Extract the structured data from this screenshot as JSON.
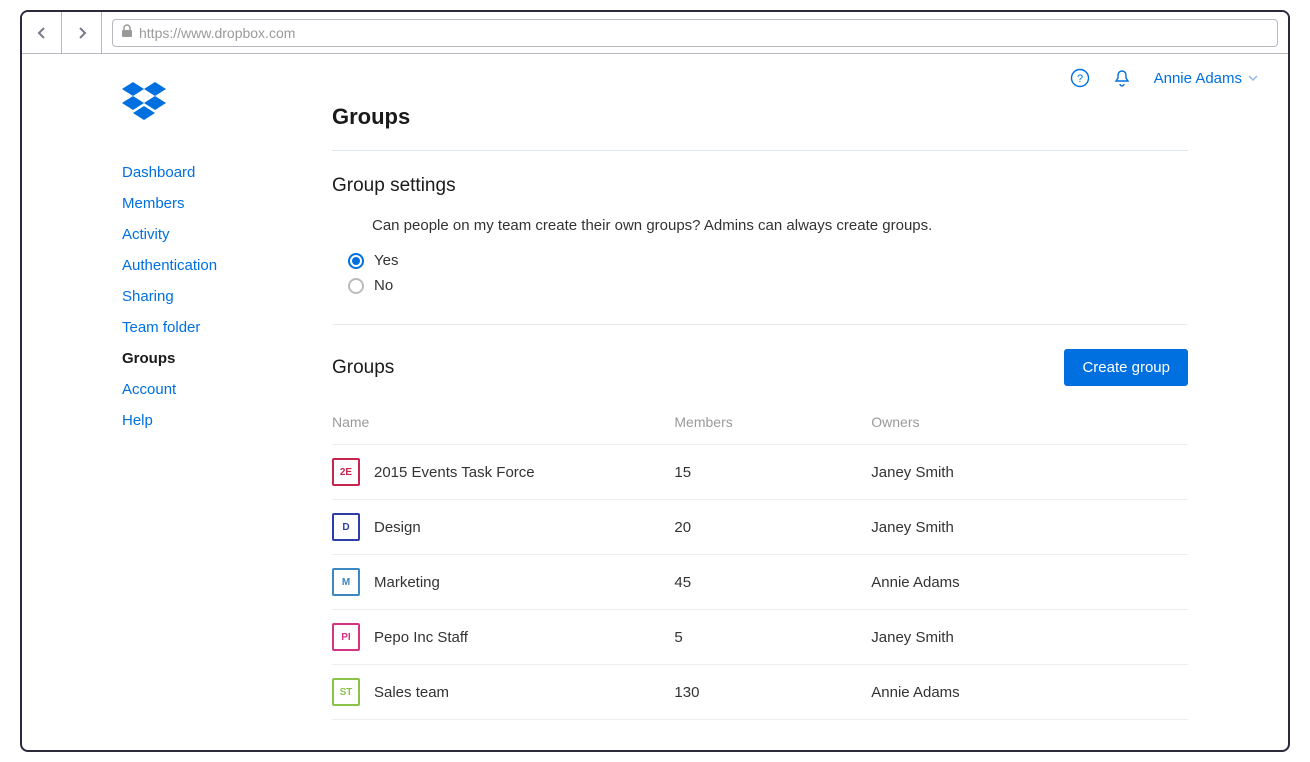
{
  "browser": {
    "url": "https://www.dropbox.com"
  },
  "topbar": {
    "user_name": "Annie Adams"
  },
  "sidebar": {
    "items": [
      {
        "label": "Dashboard",
        "active": false
      },
      {
        "label": "Members",
        "active": false
      },
      {
        "label": "Activity",
        "active": false
      },
      {
        "label": "Authentication",
        "active": false
      },
      {
        "label": "Sharing",
        "active": false
      },
      {
        "label": "Team folder",
        "active": false
      },
      {
        "label": "Groups",
        "active": true
      },
      {
        "label": "Account",
        "active": false
      },
      {
        "label": "Help",
        "active": false
      }
    ]
  },
  "page": {
    "title": "Groups",
    "settings_title": "Group settings",
    "settings_question": "Can people on my team create their own groups? Admins can always create groups.",
    "radio_yes": "Yes",
    "radio_no": "No",
    "groups_title": "Groups",
    "create_button": "Create group",
    "columns": {
      "name": "Name",
      "members": "Members",
      "owners": "Owners"
    }
  },
  "groups": [
    {
      "badge": "2E",
      "badge_class": "badge-red",
      "name": "2015 Events Task Force",
      "members": "15",
      "owner": "Janey Smith"
    },
    {
      "badge": "D",
      "badge_class": "badge-blue",
      "name": "Design",
      "members": "20",
      "owner": "Janey Smith"
    },
    {
      "badge": "M",
      "badge_class": "badge-lightblue",
      "name": "Marketing",
      "members": "45",
      "owner": "Annie Adams"
    },
    {
      "badge": "PI",
      "badge_class": "badge-pink",
      "name": "Pepo Inc Staff",
      "members": "5",
      "owner": "Janey Smith"
    },
    {
      "badge": "ST",
      "badge_class": "badge-green",
      "name": "Sales team",
      "members": "130",
      "owner": "Annie Adams"
    }
  ]
}
